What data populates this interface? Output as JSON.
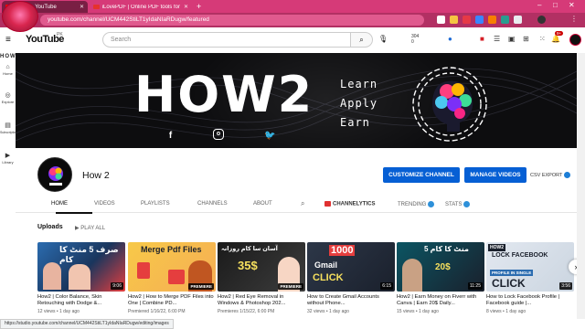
{
  "browser": {
    "tabs": [
      {
        "label": "How 2 - YouTube",
        "active": true
      },
      {
        "label": "iLovePDF | Online PDF tools for PD",
        "active": false
      }
    ],
    "new_tab": "+",
    "url": "youtube.com/channel/UCM442StiLT1yIdaNIaRDugw/featured"
  },
  "header": {
    "logo_text": "YouTube",
    "country": "PK",
    "search_placeholder": "Search",
    "stats": {
      "line1": "304",
      "line2": "0"
    },
    "notification_count": "9+"
  },
  "rail": {
    "brand": "HOW2",
    "items": [
      "Home",
      "Explore",
      "Subscriptions",
      "Library"
    ]
  },
  "banner": {
    "title": "HOW2",
    "words": [
      "Learn",
      "Apply",
      "Earn"
    ],
    "social": [
      "facebook-icon",
      "instagram-icon",
      "twitter-icon"
    ]
  },
  "channel": {
    "name": "How 2",
    "customize_label": "CUSTOMIZE CHANNEL",
    "manage_label": "MANAGE VIDEOS",
    "csv_label": "CSV EXPORT"
  },
  "tabs": [
    "HOME",
    "VIDEOS",
    "PLAYLISTS",
    "CHANNELS",
    "ABOUT",
    "CHANNELYTICS",
    "TRENDING",
    "STATS"
  ],
  "section": {
    "title": "Uploads",
    "play_all": "PLAY ALL"
  },
  "videos": [
    {
      "title": "How2 | Color Balance, Skin Retouching with Dodge &...",
      "meta": "12 views • 1 day ago",
      "badge": "9:06",
      "thumb_text": "صرف 5 منٹ کا کام"
    },
    {
      "title": "How2 | How to Merge PDF Files into One | Combine PD...",
      "meta": "Premiered 1/16/22, 6:00 PM",
      "badge": "PREMIERE",
      "thumb_text": "Merge Pdf Files"
    },
    {
      "title": "How2 | Red Eye Removal in Windows & Photoshop 202...",
      "meta": "Premieres 1/15/22, 6:00 PM",
      "badge": "PREMIERE",
      "thumb_text": "35$"
    },
    {
      "title": "How to Create Gmail Accounts without Phone...",
      "meta": "32 views • 1 day ago",
      "badge": "6:15",
      "thumb_text": "1000"
    },
    {
      "title": "How2 | Earn Money on Fiverr with Canva | Earn 20$ Daily...",
      "meta": "15 views • 1 day ago",
      "badge": "11:25",
      "thumb_text": "5 منٹ کا کام"
    },
    {
      "title": "How to Lock Facebook Profile | Facebook guide |...",
      "meta": "8 views • 1 day ago",
      "badge": "3:56",
      "thumb_text": "LOCK FACEBOOK"
    }
  ],
  "status_url": "https://studio.youtube.com/channel/UCM442StiLT1yIdaNIaRDugw/editing/images"
}
